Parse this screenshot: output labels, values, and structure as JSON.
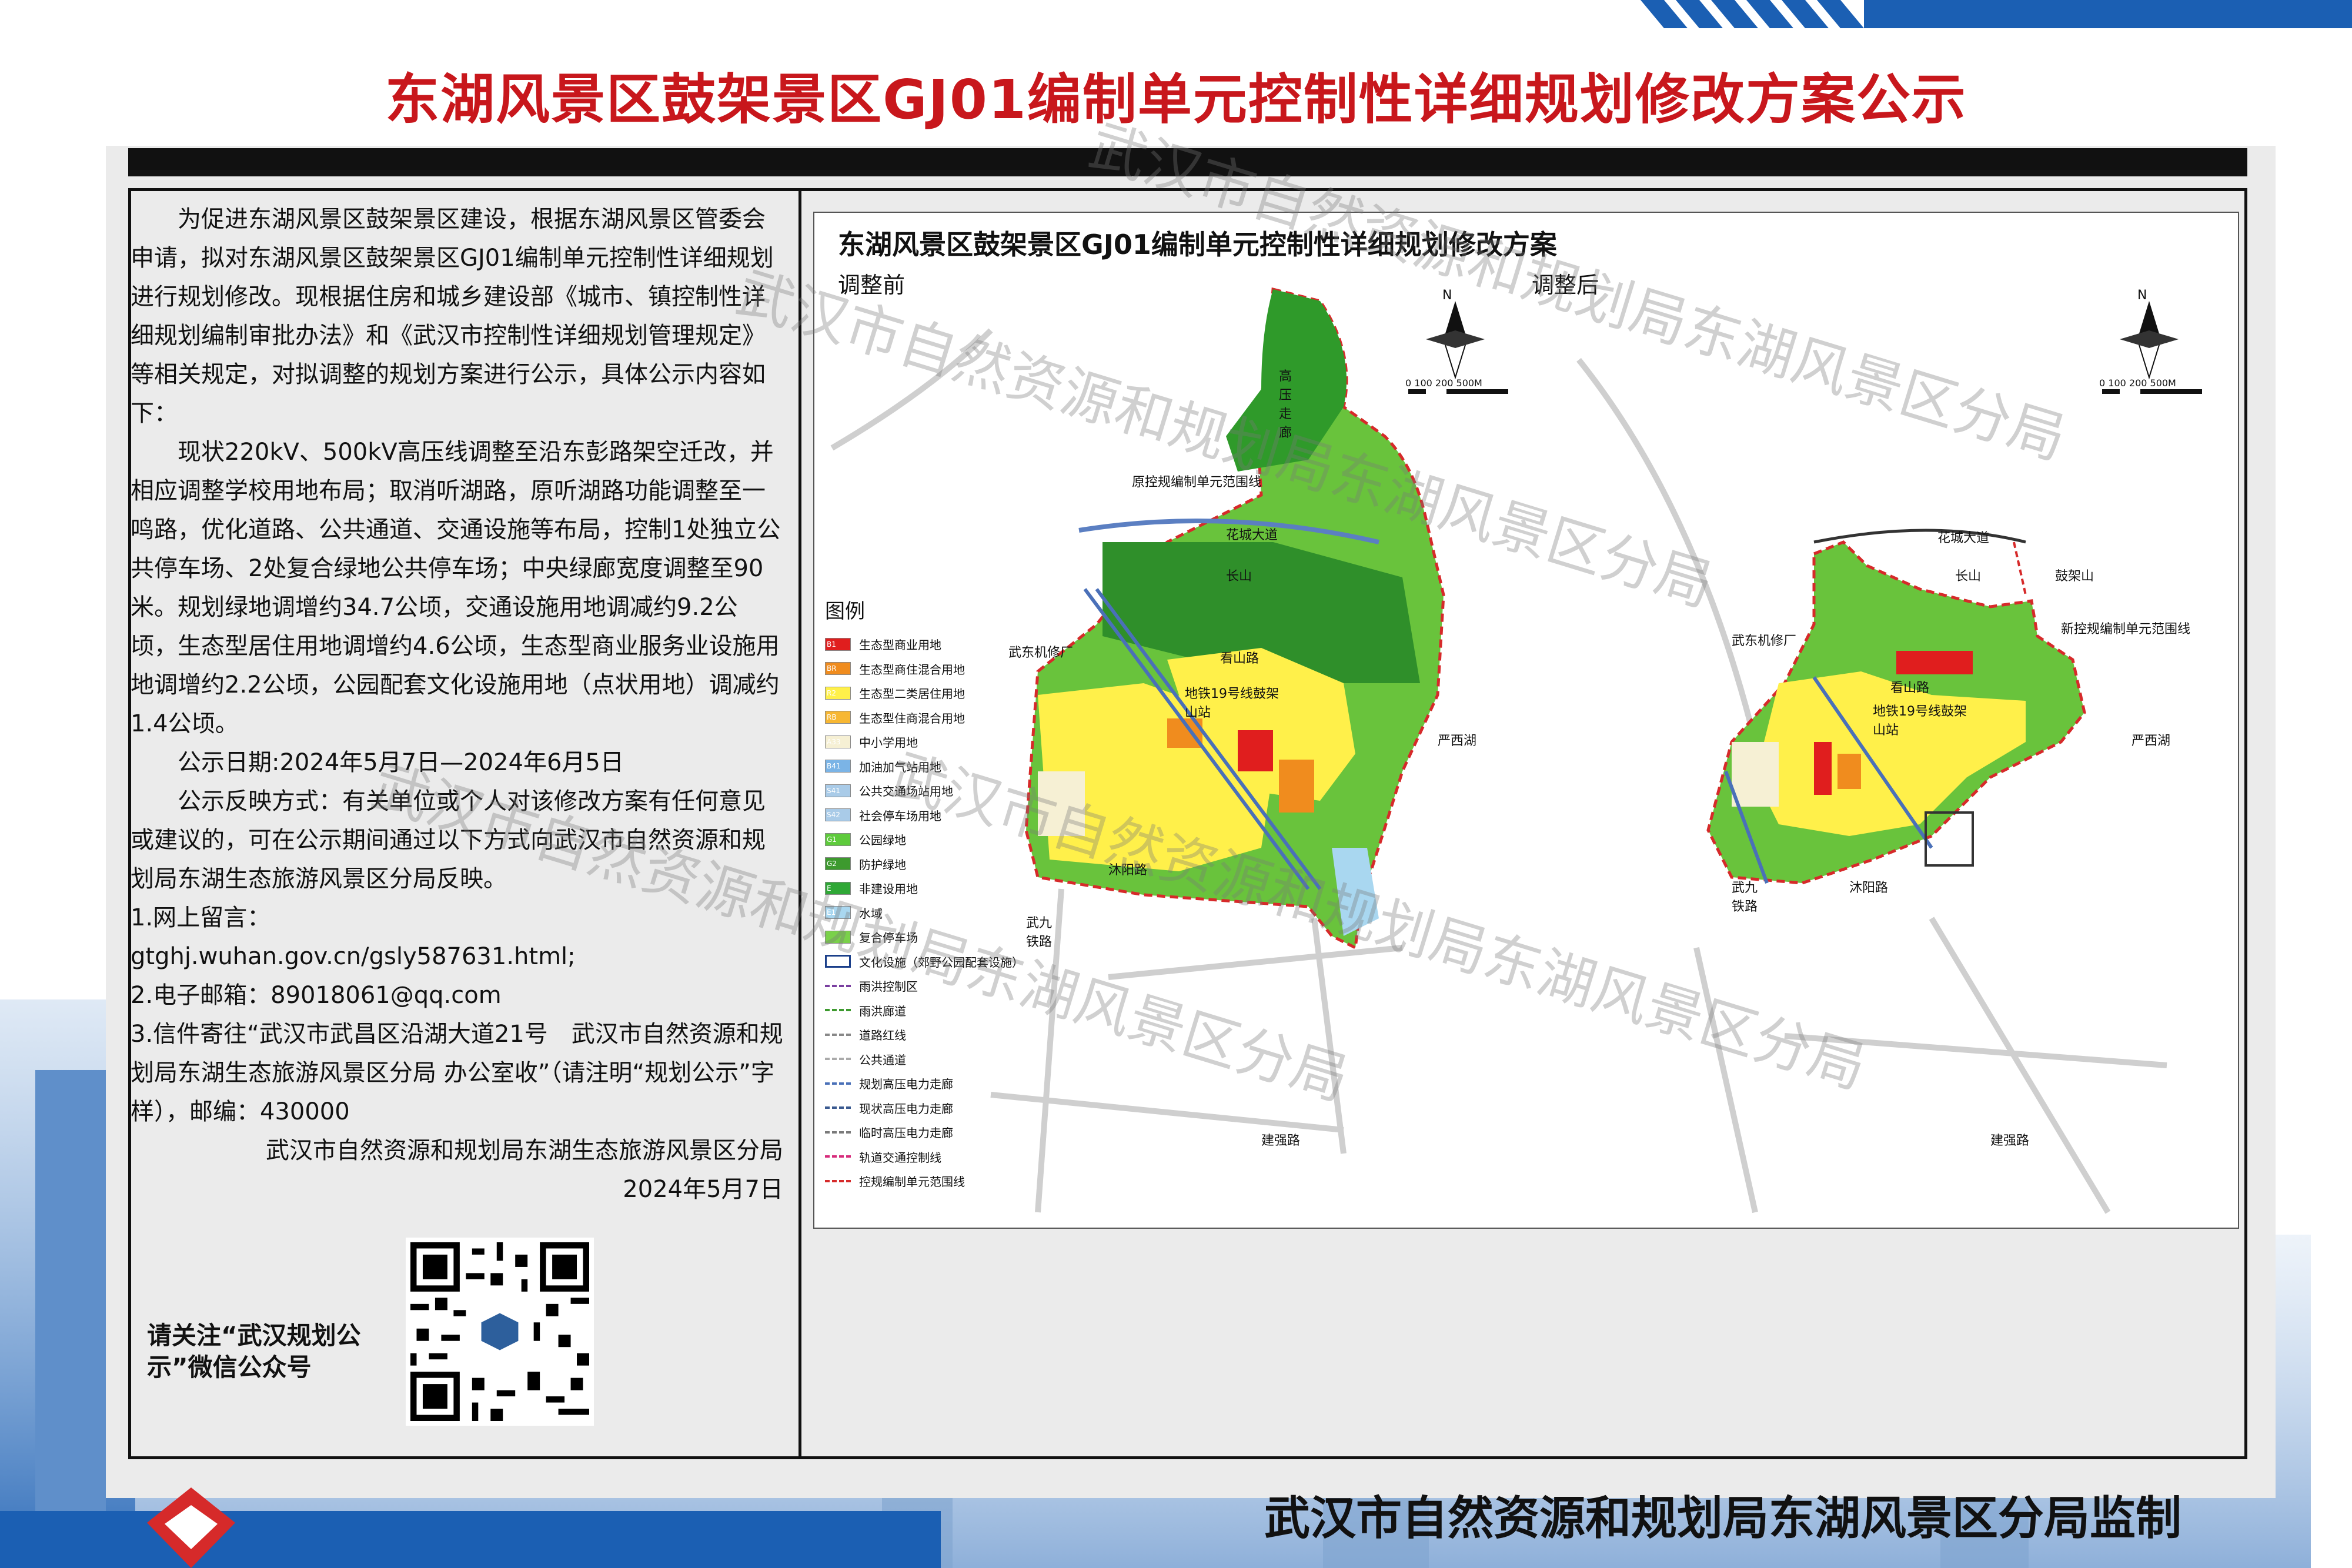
{
  "title": "东湖风景区鼓架景区GJ01编制单元控制性详细规划修改方案公示",
  "notice": {
    "paragraphs": [
      "为促进东湖风景区鼓架景区建设，根据东湖风景区管委会申请，拟对东湖风景区鼓架景区GJ01编制单元控制性详细规划进行规划修改。现根据住房和城乡建设部《城市、镇控制性详细规划编制审批办法》和《武汉市控制性详细规划管理规定》等相关规定，对拟调整的规划方案进行公示，具体公示内容如下：",
      "现状220kV、500kV高压线调整至沿东彭路架空迁改，并相应调整学校用地布局；取消听湖路，原听湖路功能调整至一鸣路，优化道路、公共通道、交通设施等布局，控制1处独立公共停车场、2处复合绿地公共停车场；中央绿廊宽度调整至90米。规划绿地调增约34.7公顷，交通设施用地调减约9.2公顷，生态型居住用地调增约4.6公顷，生态型商业服务业设施用地调增约2.2公顷，公园配套文化设施用地（点状用地）调减约1.4公顷。",
      "公示日期:2024年5月7日—2024年6月5日",
      "公示反映方式：有关单位或个人对该修改方案有任何意见或建议的，可在公示期间通过以下方式向武汉市自然资源和规划局东湖生态旅游风景区分局反映。"
    ],
    "contact_1_label": "1.网上留言：",
    "contact_1_url": "gtghj.wuhan.gov.cn/gsly587631.html;",
    "contact_2": "2.电子邮箱：89018061@qq.com",
    "contact_3": "3.信件寄往“武汉市武昌区沿湖大道21号　武汉市自然资源和规划局东湖生态旅游风景区分局 办公室收”（请注明“规划公示”字样），邮编：430000",
    "signature": "武汉市自然资源和规划局东湖生态旅游风景区分局",
    "date": "2024年5月7日"
  },
  "qr_caption": "请关注“武汉规划公示”微信公众号",
  "map": {
    "title": "东湖风景区鼓架景区GJ01编制单元控制性详细规划修改方案",
    "before_label": "调整前",
    "after_label": "调整后",
    "north_label": "N",
    "scale_label": "0 100 200        500M",
    "legend_title": "图例",
    "legend": [
      {
        "code": "B1",
        "label": "生态型商业用地",
        "color": "#e01e1e"
      },
      {
        "code": "BR",
        "label": "生态型商住混合用地",
        "color": "#f08c1e"
      },
      {
        "code": "R2",
        "label": "生态型二类居住用地",
        "color": "#fff04a"
      },
      {
        "code": "RB",
        "label": "生态型住商混合用地",
        "color": "#f7b733"
      },
      {
        "code": "A33",
        "label": "中小学用地",
        "color": "#f6f0d4"
      },
      {
        "code": "B41",
        "label": "加油加气站用地",
        "color": "#7bb4e6"
      },
      {
        "code": "S41",
        "label": "公共交通场站用地",
        "color": "#a9cbe8"
      },
      {
        "code": "S42",
        "label": "社会停车场用地",
        "color": "#a9cbe8"
      },
      {
        "code": "G1",
        "label": "公园绿地",
        "color": "#5ecb3c"
      },
      {
        "code": "G2",
        "label": "防护绿地",
        "color": "#3d9a2e"
      },
      {
        "code": "E",
        "label": "非建设用地",
        "color": "#2fa836"
      },
      {
        "code": "E1",
        "label": "水域",
        "color": "#a9d7f0"
      },
      {
        "code": "",
        "label": "复合停车场",
        "color": "#7ad14a"
      },
      {
        "code": "",
        "label": "文化设施（郊野公园配套设施）",
        "color": "#ffffff"
      },
      {
        "code": "",
        "label": "雨洪控制区",
        "color": ""
      },
      {
        "code": "",
        "label": "雨洪廊道",
        "color": ""
      },
      {
        "code": "",
        "label": "道路红线",
        "color": ""
      },
      {
        "code": "",
        "label": "公共通道",
        "color": ""
      },
      {
        "code": "",
        "label": "规划高压电力走廊",
        "color": ""
      },
      {
        "code": "",
        "label": "现状高压电力走廊",
        "color": ""
      },
      {
        "code": "",
        "label": "临时高压电力走廊",
        "color": ""
      },
      {
        "code": "",
        "label": "轨道交通控制线",
        "color": ""
      },
      {
        "code": "",
        "label": "控规编制单元范围线",
        "color": ""
      }
    ],
    "labels_before": {
      "hk": "花城大道",
      "cs": "长山",
      "wdjx": "武东机修厂",
      "ksl": "看山路",
      "dt": "地铁19号线鼓架山站",
      "ysh": "严西湖",
      "myl": "沐阳路",
      "wj": "武九铁路",
      "jql": "建强路",
      "gy": "高压走廊",
      "ykg": "原控规编制单元范围线"
    },
    "labels_after": {
      "hk": "花城大道",
      "cs": "长山",
      "gjs": "鼓架山",
      "xkg": "新控规编制单元范围线",
      "wdjx": "武东机修厂",
      "ksl": "看山路",
      "dt": "地铁19号线鼓架山站",
      "ysh": "严西湖",
      "myl": "沐阳路",
      "wj": "武九铁路",
      "jql": "建强路"
    }
  },
  "footer": "武汉市自然资源和规划局东湖风景区分局监制",
  "watermark": "武汉市自然资源和规划局东湖风景区分局"
}
